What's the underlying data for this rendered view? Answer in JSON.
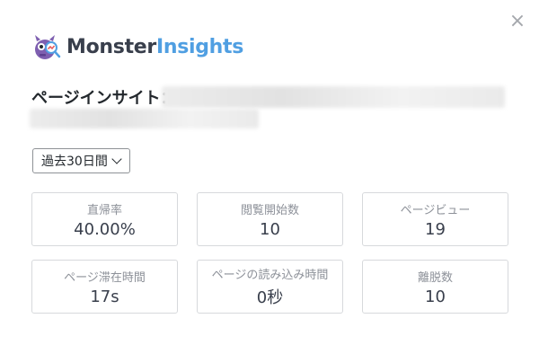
{
  "dialog": {
    "close_symbol": "×"
  },
  "brand": {
    "name_part1": "Monster",
    "name_part2": "Insights",
    "logo_icon": "monster-logo-icon"
  },
  "page_insight": {
    "label": "ページインサイト："
  },
  "period_select": {
    "selected": "過去30日間"
  },
  "metrics": [
    {
      "label": "直帰率",
      "value": "40.00%"
    },
    {
      "label": "閲覧開始数",
      "value": "10"
    },
    {
      "label": "ページビュー",
      "value": "19"
    },
    {
      "label": "ページ滞在時間",
      "value": "17s"
    },
    {
      "label": "ページの読み込み時間",
      "value": "0秒"
    },
    {
      "label": "離脱数",
      "value": "10"
    }
  ],
  "colors": {
    "brand_dark": "#393f4c",
    "brand_blue": "#509fe2",
    "card_border": "#d7d9dc",
    "label_gray": "#8d9199"
  }
}
